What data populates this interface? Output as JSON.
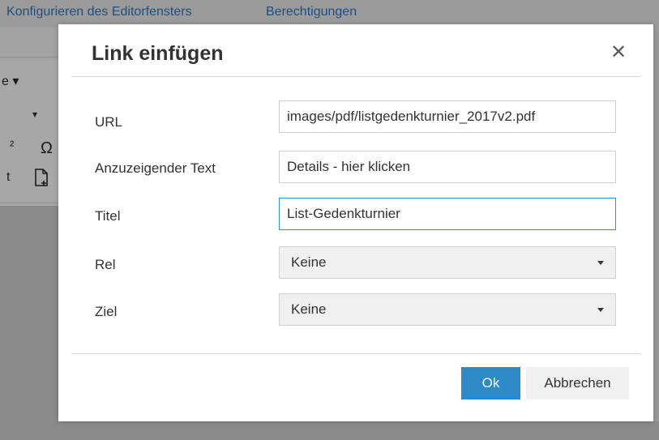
{
  "background": {
    "tabs": [
      "Konfigurieren des Editorfensters",
      "Berechtigungen"
    ],
    "toolbar_glyphs": [
      "e ▾",
      "▾",
      "²",
      "Ω",
      "t",
      "new-document-icon"
    ]
  },
  "dialog": {
    "title": "Link einfügen",
    "close_glyph": "✕",
    "fields": {
      "url": {
        "label": "URL",
        "value": "images/pdf/listgedenkturnier_2017v2.pdf"
      },
      "text": {
        "label": "Anzuzeigender Text",
        "value": "Details - hier klicken"
      },
      "title": {
        "label": "Titel",
        "value": "List-Gedenkturnier"
      },
      "rel": {
        "label": "Rel",
        "selected": "Keine"
      },
      "target": {
        "label": "Ziel",
        "selected": "Keine"
      }
    },
    "buttons": {
      "ok": "Ok",
      "cancel": "Abbrechen"
    }
  },
  "colors": {
    "primary": "#2d8ac7",
    "focus": "#2f8fd8",
    "tab_text": "#1e4f7e"
  }
}
